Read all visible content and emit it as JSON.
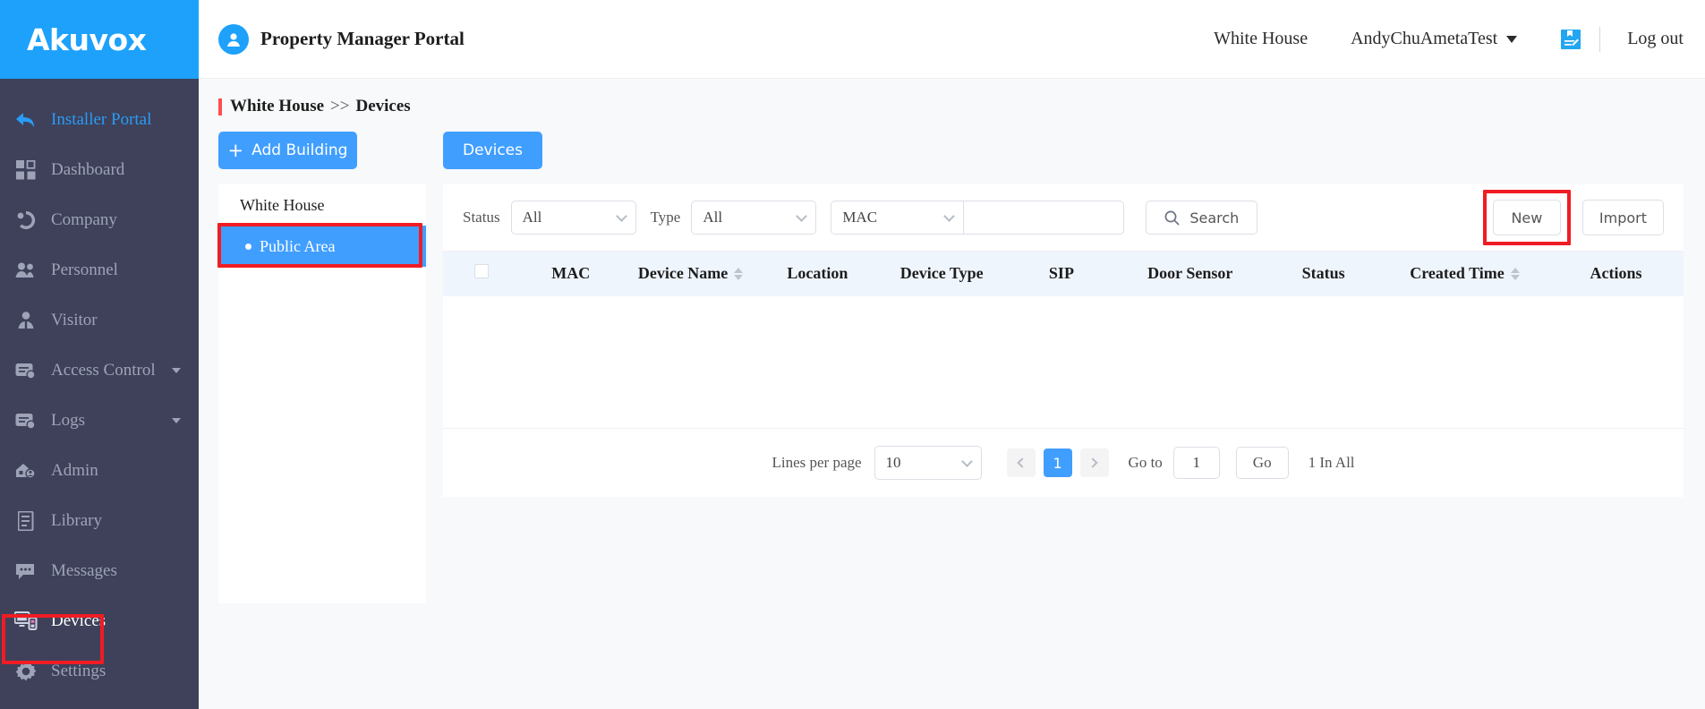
{
  "brand": {
    "logo_text": "Akuvox",
    "logo_bg": "#1da1fb",
    "sidebar_bg": "#3e4159",
    "accent": "#409eff",
    "annotation": "#f01c24"
  },
  "topbar": {
    "portal_title": "Property Manager Portal",
    "avatar_icon": "user-avatar-icon",
    "site_link": "White House",
    "account_name": "AndyChuAmetaTest",
    "note_icon": "note-edit-icon",
    "logout_label": "Log out"
  },
  "sidebar": {
    "items": [
      {
        "label": "Installer Portal",
        "icon": "back-arrow-icon",
        "state": "link"
      },
      {
        "label": "Dashboard",
        "icon": "dashboard-grid-icon",
        "state": "normal"
      },
      {
        "label": "Company",
        "icon": "company-icon",
        "state": "normal"
      },
      {
        "label": "Personnel",
        "icon": "personnel-users-icon",
        "state": "normal"
      },
      {
        "label": "Visitor",
        "icon": "visitor-person-icon",
        "state": "normal"
      },
      {
        "label": "Access Control",
        "icon": "access-control-card-icon",
        "state": "normal",
        "expandable": true
      },
      {
        "label": "Logs",
        "icon": "logs-card-icon",
        "state": "normal",
        "expandable": true
      },
      {
        "label": "Admin",
        "icon": "admin-house-user-icon",
        "state": "normal"
      },
      {
        "label": "Library",
        "icon": "library-book-icon",
        "state": "normal"
      },
      {
        "label": "Messages",
        "icon": "messages-chat-icon",
        "state": "normal"
      },
      {
        "label": "Devices",
        "icon": "devices-monitor-icon",
        "state": "active",
        "annotated": true
      },
      {
        "label": "Settings",
        "icon": "settings-gear-icon",
        "state": "normal"
      }
    ]
  },
  "breadcrumb": {
    "root": "White House",
    "separator": ">>",
    "current": "Devices"
  },
  "tree": {
    "add_building_label": "Add Building",
    "add_building_icon": "plus-icon",
    "nodes": [
      {
        "label": "White House",
        "selected": false,
        "annotated": false
      },
      {
        "label": "Public Area",
        "selected": true,
        "annotated": true,
        "bullet": "dot-icon"
      }
    ]
  },
  "tab": {
    "label": "Devices"
  },
  "filters": {
    "status_label": "Status",
    "status_value": "All",
    "type_label": "Type",
    "type_value": "All",
    "field_value": "MAC",
    "keyword_value": "",
    "keyword_placeholder": "",
    "search_label": "Search",
    "search_icon": "search-icon",
    "new_label": "New",
    "import_label": "Import"
  },
  "table": {
    "select_all_icon": "checkbox-icon",
    "columns": [
      {
        "label": "MAC",
        "sortable": false
      },
      {
        "label": "Device Name",
        "sortable": true
      },
      {
        "label": "Location",
        "sortable": false
      },
      {
        "label": "Device Type",
        "sortable": false
      },
      {
        "label": "SIP",
        "sortable": false
      },
      {
        "label": "Door Sensor",
        "sortable": false
      },
      {
        "label": "Status",
        "sortable": false
      },
      {
        "label": "Created Time",
        "sortable": true
      },
      {
        "label": "Actions",
        "sortable": false
      }
    ],
    "rows": []
  },
  "pagination": {
    "lines_label": "Lines per page",
    "lines_value": "10",
    "prev_icon": "chevron-left-icon",
    "next_icon": "chevron-right-icon",
    "current_page": "1",
    "goto_label": "Go to",
    "goto_value": "1",
    "go_label": "Go",
    "total_label": "1 In All"
  }
}
